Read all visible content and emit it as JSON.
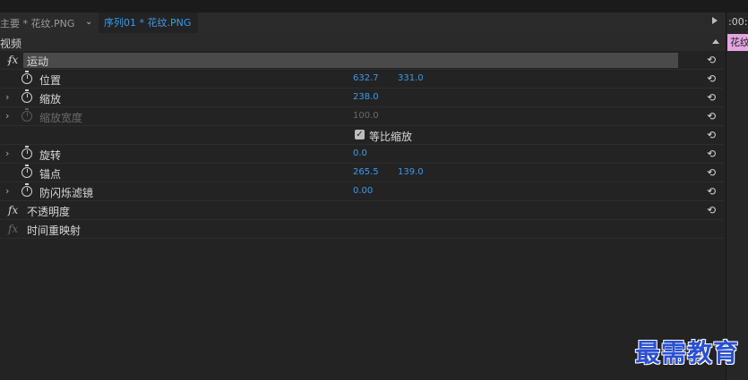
{
  "tabs": {
    "master_label": "主要 * 花纹.PNG",
    "dropdown_icon": "chevron-down-icon",
    "sequence_label": "序列01 * 花纹.PNG"
  },
  "timeline": {
    "timecode": ":00:0",
    "clip_label": "花纹"
  },
  "section": {
    "video_label": "视频"
  },
  "effects": {
    "motion": {
      "label": "运动",
      "position": {
        "label": "位置",
        "x": "632.7",
        "y": "331.0"
      },
      "scale": {
        "label": "缩放",
        "value": "238.0"
      },
      "scale_width": {
        "label": "缩放宽度",
        "value": "100.0"
      },
      "uniform_scale": {
        "label": "等比缩放",
        "checked": true
      },
      "rotation": {
        "label": "旋转",
        "value": "0.0"
      },
      "anchor": {
        "label": "锚点",
        "x": "265.5",
        "y": "139.0"
      },
      "anti_flicker": {
        "label": "防闪烁滤镜",
        "value": "0.00"
      }
    },
    "opacity": {
      "label": "不透明度"
    },
    "time_remap": {
      "label": "时间重映射"
    }
  },
  "watermark": {
    "text": "最需教育"
  },
  "colors": {
    "value_blue": "#3d9ae8",
    "clip_pink": "#e4a6e0",
    "panel_bg": "#232323"
  }
}
